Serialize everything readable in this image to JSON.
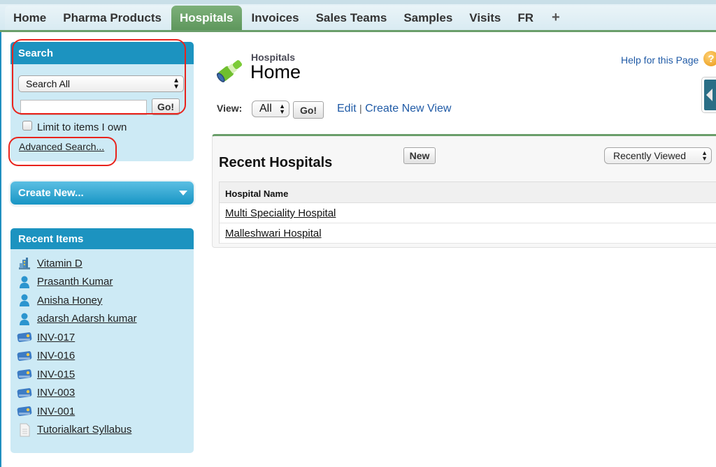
{
  "tabs": [
    {
      "label": "Home",
      "active": false
    },
    {
      "label": "Pharma Products",
      "active": false
    },
    {
      "label": "Hospitals",
      "active": true
    },
    {
      "label": "Invoices",
      "active": false
    },
    {
      "label": "Sales Teams",
      "active": false
    },
    {
      "label": "Samples",
      "active": false
    },
    {
      "label": "Visits",
      "active": false
    },
    {
      "label": "FR",
      "active": false
    }
  ],
  "tabs_plus": "+",
  "sidebar": {
    "search": {
      "title": "Search",
      "scope_selected": "Search All",
      "query_value": "",
      "go_label": "Go!",
      "limit_label": "Limit to items I own",
      "limit_checked": false,
      "advanced_label": "Advanced Search..."
    },
    "create_new_label": "Create New...",
    "recent": {
      "title": "Recent Items",
      "items": [
        {
          "label": "Vitamin D",
          "icon": "product-icon"
        },
        {
          "label": "Prasanth Kumar",
          "icon": "person-icon"
        },
        {
          "label": "Anisha Honey",
          "icon": "person-icon"
        },
        {
          "label": "adarsh Adarsh kumar",
          "icon": "person-icon"
        },
        {
          "label": "INV-017",
          "icon": "invoice-card-icon"
        },
        {
          "label": "INV-016",
          "icon": "invoice-card-icon"
        },
        {
          "label": "INV-015",
          "icon": "invoice-card-icon"
        },
        {
          "label": "INV-003",
          "icon": "invoice-card-icon"
        },
        {
          "label": "INV-001",
          "icon": "invoice-card-icon"
        },
        {
          "label": "Tutorialkart Syllabus",
          "icon": "document-icon"
        }
      ]
    }
  },
  "header": {
    "object_type": "Hospitals",
    "title": "Home",
    "help_label": "Help for this Page",
    "help_icon": "?"
  },
  "view": {
    "label": "View:",
    "selected": "All",
    "go_label": "Go!",
    "edit_label": "Edit",
    "separator": "|",
    "create_view_label": "Create New View"
  },
  "recent_panel": {
    "title": "Recent Hospitals",
    "new_label": "New",
    "filter_selected": "Recently Viewed",
    "column_header": "Hospital Name",
    "rows": [
      "Multi Speciality Hospital",
      "Malleshwari Hospital"
    ]
  },
  "colors": {
    "active_tab": "#6a9e6a",
    "sidebar_header": "#1c93c0",
    "sidebar_body": "#cdeaf5",
    "link_blue": "#1f5aa6",
    "annotation_red": "#e8231c"
  }
}
